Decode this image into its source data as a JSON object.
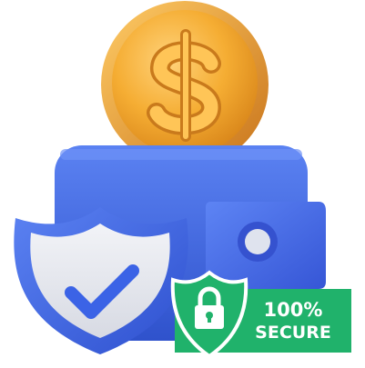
{
  "illustration": {
    "subject": "wallet-with-coin-shield-and-secure-badge",
    "coin_icon": "dollar-coin-icon",
    "wallet_icon": "wallet-icon",
    "shield_icon": "shield-check-icon",
    "lock_icon": "padlock-icon"
  },
  "badge": {
    "line1": "100%",
    "line2": "SECURE"
  },
  "colors": {
    "coin_gold": "#f2a62a",
    "coin_highlight": "#ffd27a",
    "wallet_blue": "#3d64e0",
    "wallet_blue_light": "#5b82f2",
    "shield_blue": "#3b63e6",
    "shield_inner": "#e8eaf0",
    "badge_green": "#20b26b",
    "badge_white": "#ffffff"
  }
}
